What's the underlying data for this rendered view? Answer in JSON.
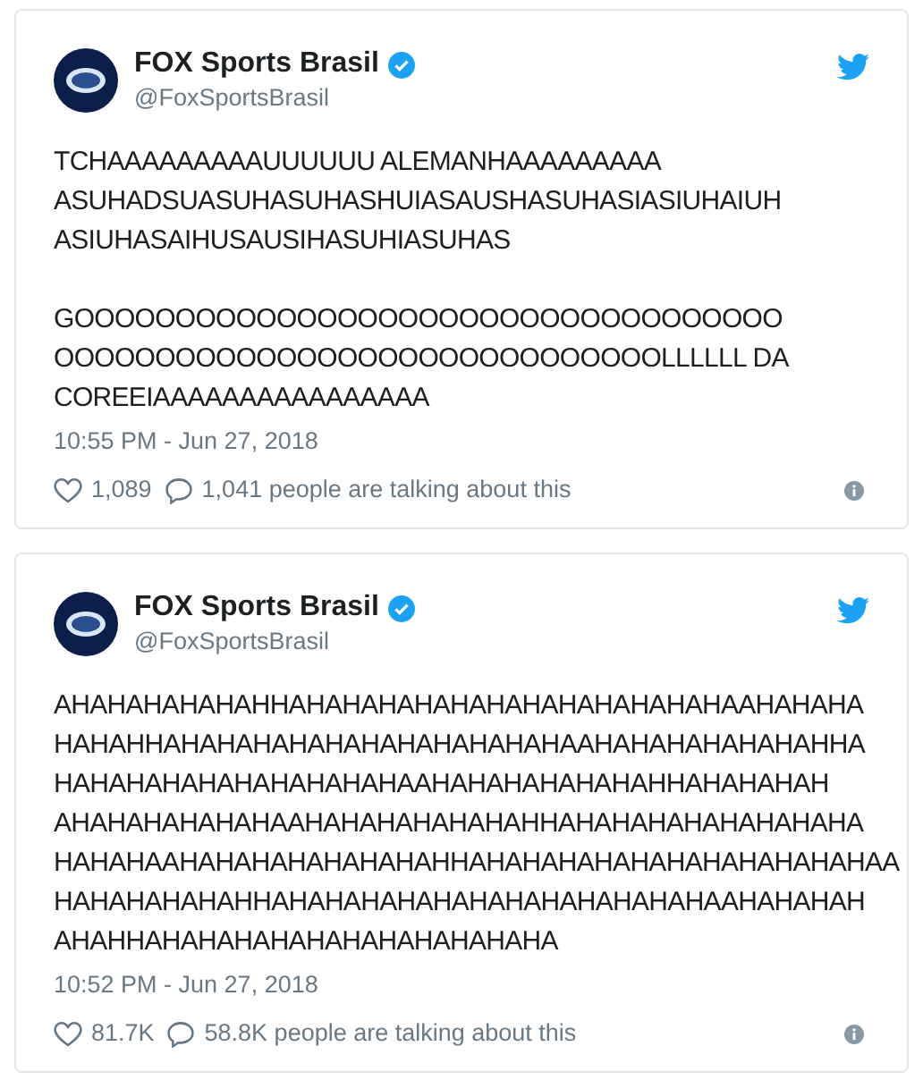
{
  "tweets": [
    {
      "name": "FOX Sports Brasil",
      "verified": true,
      "handle": "@FoxSportsBrasil",
      "paragraphs": [
        [
          "TCHAAAAAAAAAUUUUUU ALEMANHAAAAAAAAA",
          "ASUHADSUASUHASUHASHUIASAUSHASUHASIASIUHAIUH",
          "ASIUHASAIHUSAUSIHASUHIASUHAS"
        ],
        [
          "GOOOOOOOOOOOOOOOOOOOOOOOOOOOOOOOOOOO",
          "OOOOOOOOOOOOOOOOOOOOOOOOOOOOOOLLLLLL DA",
          "COREEIAAAAAAAAAAAAAAAA"
        ]
      ],
      "timestamp": "10:55 PM - Jun 27, 2018",
      "likes": "1,089",
      "talking": "1,041 people are talking about this"
    },
    {
      "name": "FOX Sports Brasil",
      "verified": true,
      "handle": "@FoxSportsBrasil",
      "paragraphs": [
        [
          "AHAHAHAHAHAHHAHAHAHAHAHAHAHAHAHAHAHAHAAHAHAHA",
          "HAHAHHAHAHAHAHAHAHAHAHAHAHAHAAHAHAHAHAHAHAHHA",
          "HAHAHAHAHAHAHAHAHAHAAHAHAHAHAHAHAHHAHAHAHAH",
          "AHAHAHAHAHAHAAHAHAHAHAHAHAHHAHAHAHAHAHAHAHAHA",
          "HAHAHAAHAHAHAHAHAHAHAHHAHAHAHAHAHAHAHAHAHAHAHAA",
          "HAHAHAHAHAHHAHAHAHAHAHAHAHAHAHAHAHAHAAHAHAHAH",
          "AHAHHAHAHAHAHAHAHAHAHAHAHAHA"
        ]
      ],
      "timestamp": "10:52 PM - Jun 27, 2018",
      "likes": "81.7K",
      "talking": "58.8K people are talking about this"
    }
  ]
}
